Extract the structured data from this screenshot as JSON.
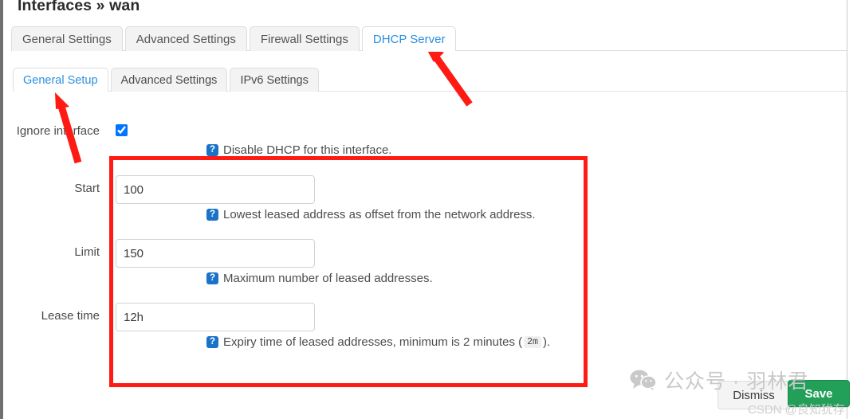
{
  "header": {
    "title": "Interfaces » wan"
  },
  "outer_tabs": [
    {
      "label": "General Settings",
      "active": false
    },
    {
      "label": "Advanced Settings",
      "active": false
    },
    {
      "label": "Firewall Settings",
      "active": false
    },
    {
      "label": "DHCP Server",
      "active": true
    }
  ],
  "inner_tabs": [
    {
      "label": "General Setup",
      "active": true
    },
    {
      "label": "Advanced Settings",
      "active": false
    },
    {
      "label": "IPv6 Settings",
      "active": false
    }
  ],
  "form": {
    "ignore_interface": {
      "label": "Ignore interface",
      "checked": true,
      "hint": "Disable DHCP for this interface.",
      "help_icon": "help-question-icon"
    },
    "start": {
      "label": "Start",
      "value": "100",
      "hint": "Lowest leased address as offset from the network address.",
      "help_icon": "help-question-icon"
    },
    "limit": {
      "label": "Limit",
      "value": "150",
      "hint": "Maximum number of leased addresses.",
      "help_icon": "help-question-icon"
    },
    "lease_time": {
      "label": "Lease time",
      "value": "12h",
      "hint_before": "Expiry time of leased addresses, minimum is 2 minutes (",
      "hint_code": "2m",
      "hint_after": ").",
      "help_icon": "help-question-icon"
    }
  },
  "footer": {
    "dismiss_label": "Dismiss",
    "save_label": "Save"
  },
  "annotations": {
    "highlight_color": "#ff1a13",
    "box_target": "dhcp-address-pool-fields",
    "arrow_1_target": "DHCP Server",
    "arrow_2_target": "General Setup"
  },
  "watermarks": {
    "wechat_icon": "wechat-logo-icon",
    "wechat_text": "公众号 · 羽林君",
    "csdn_text": "CSDN @良知犹存"
  }
}
